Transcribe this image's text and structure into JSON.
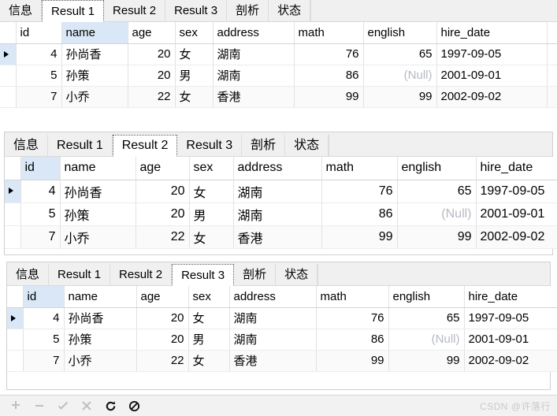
{
  "window": {
    "background": "#ffffff",
    "accent_highlight": "#d9e7f7"
  },
  "panels": [
    {
      "name": "result-panel-1",
      "tabs": [
        {
          "label": "信息",
          "selected": false
        },
        {
          "label": "Result 1",
          "selected": true
        },
        {
          "label": "Result 2",
          "selected": false
        },
        {
          "label": "Result 3",
          "selected": false
        },
        {
          "label": "剖析",
          "selected": false
        },
        {
          "label": "状态",
          "selected": false
        }
      ],
      "highlighted_column": "name",
      "columns": [
        "id",
        "name",
        "age",
        "sex",
        "address",
        "math",
        "english",
        "hire_date"
      ],
      "rows": [
        {
          "current": true,
          "id": "4",
          "name": "孙尚香",
          "age": "20",
          "sex": "女",
          "address": "湖南",
          "math": "76",
          "english": "65",
          "hire_date": "1997-09-05",
          "english_null": false
        },
        {
          "current": false,
          "id": "5",
          "name": "孙策",
          "age": "20",
          "sex": "男",
          "address": "湖南",
          "math": "86",
          "english": "(Null)",
          "hire_date": "2001-09-01",
          "english_null": true
        },
        {
          "current": false,
          "id": "7",
          "name": "小乔",
          "age": "22",
          "sex": "女",
          "address": "香港",
          "math": "99",
          "english": "99",
          "hire_date": "2002-09-02",
          "english_null": false
        }
      ]
    },
    {
      "name": "result-panel-2",
      "tabs": [
        {
          "label": "信息",
          "selected": false
        },
        {
          "label": "Result 1",
          "selected": false
        },
        {
          "label": "Result 2",
          "selected": true
        },
        {
          "label": "Result 3",
          "selected": false
        },
        {
          "label": "剖析",
          "selected": false
        },
        {
          "label": "状态",
          "selected": false
        }
      ],
      "highlighted_column": "id",
      "columns": [
        "id",
        "name",
        "age",
        "sex",
        "address",
        "math",
        "english",
        "hire_date"
      ],
      "rows": [
        {
          "current": true,
          "id": "4",
          "name": "孙尚香",
          "age": "20",
          "sex": "女",
          "address": "湖南",
          "math": "76",
          "english": "65",
          "hire_date": "1997-09-05",
          "english_null": false
        },
        {
          "current": false,
          "id": "5",
          "name": "孙策",
          "age": "20",
          "sex": "男",
          "address": "湖南",
          "math": "86",
          "english": "(Null)",
          "hire_date": "2001-09-01",
          "english_null": true
        },
        {
          "current": false,
          "id": "7",
          "name": "小乔",
          "age": "22",
          "sex": "女",
          "address": "香港",
          "math": "99",
          "english": "99",
          "hire_date": "2002-09-02",
          "english_null": false
        }
      ]
    },
    {
      "name": "result-panel-3",
      "tabs": [
        {
          "label": "信息",
          "selected": false
        },
        {
          "label": "Result 1",
          "selected": false
        },
        {
          "label": "Result 2",
          "selected": false
        },
        {
          "label": "Result 3",
          "selected": true
        },
        {
          "label": "剖析",
          "selected": false
        },
        {
          "label": "状态",
          "selected": false
        }
      ],
      "highlighted_column": "id",
      "columns": [
        "id",
        "name",
        "age",
        "sex",
        "address",
        "math",
        "english",
        "hire_date"
      ],
      "rows": [
        {
          "current": true,
          "id": "4",
          "name": "孙尚香",
          "age": "20",
          "sex": "女",
          "address": "湖南",
          "math": "76",
          "english": "65",
          "hire_date": "1997-09-05",
          "english_null": false
        },
        {
          "current": false,
          "id": "5",
          "name": "孙策",
          "age": "20",
          "sex": "男",
          "address": "湖南",
          "math": "86",
          "english": "(Null)",
          "hire_date": "2001-09-01",
          "english_null": true
        },
        {
          "current": false,
          "id": "7",
          "name": "小乔",
          "age": "22",
          "sex": "女",
          "address": "香港",
          "math": "99",
          "english": "99",
          "hire_date": "2002-09-02",
          "english_null": false
        }
      ]
    }
  ],
  "toolbar": {
    "buttons": [
      {
        "icon": "plus-icon",
        "title": "添加记录",
        "enabled": false
      },
      {
        "icon": "minus-icon",
        "title": "删除记录",
        "enabled": false
      },
      {
        "icon": "check-icon",
        "title": "应用改变",
        "enabled": false
      },
      {
        "icon": "cross-icon",
        "title": "放弃改变",
        "enabled": false
      },
      {
        "icon": "refresh-icon",
        "title": "刷新",
        "enabled": true
      },
      {
        "icon": "stop-icon",
        "title": "停止",
        "enabled": true
      }
    ]
  },
  "watermark": {
    "text": "CSDN @许落行"
  }
}
